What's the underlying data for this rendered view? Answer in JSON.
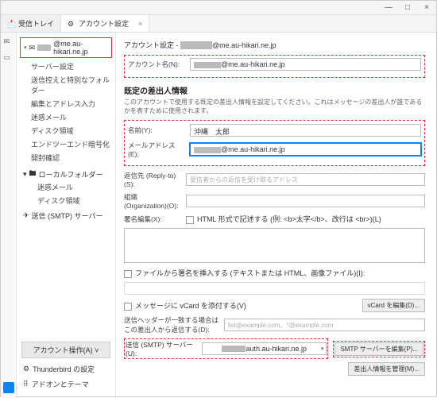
{
  "window": {
    "min": "—",
    "max": "□",
    "close": "×"
  },
  "tabs": {
    "inbox": "受信トレイ",
    "settings": "アカウント設定"
  },
  "account": {
    "domain": "@me.au-hikari.ne.jp"
  },
  "tree": {
    "server": "サーバー設定",
    "copies": "送信控えと特別なフォルダー",
    "compose": "編集とアドレス入力",
    "junk": "迷惑メール",
    "disk": "ディスク領域",
    "e2e": "エンドツーエンド暗号化",
    "receipt": "開封確認"
  },
  "local": {
    "hdr": "ローカルフォルダー",
    "junk": "迷惑メール",
    "disk": "ディスク領域"
  },
  "smtp": {
    "label": "送信 (SMTP) サーバー"
  },
  "sideops": {
    "acctops": "アカウント操作(A)",
    "tbset": "Thunderbird の設定",
    "addon": "アドオンとテーマ"
  },
  "h1": {
    "pre": "アカウント設定 - ",
    "dom": "@me.au-hikari.ne.jp"
  },
  "acctname": {
    "lbl": "アカウント名(N):",
    "val": "@me.au-hikari.ne.jp"
  },
  "sect": "既定の差出人情報",
  "hint": "このアカウントで使用する既定の差出人情報を設定してください。これはメッセージの差出人が誰であるかを表すために使用されます。",
  "name": {
    "lbl": "名前(Y):",
    "val": "沖縄　太郎"
  },
  "email": {
    "lbl": "メールアドレス(E):",
    "val": "@me.au-hikari.ne.jp"
  },
  "reply": {
    "lbl": "返信先 (Reply-to)(S):",
    "ph": "受信者からの返信を受け取るアドレス"
  },
  "org": {
    "lbl": "組織 (Organization)(O):"
  },
  "sig": {
    "lbl": "署名編集(X):",
    "cb": "HTML 形式で記述する (例: <b>太字</b>、改行は <br>)(L)"
  },
  "filesig": {
    "cb": "ファイルから署名を挿入する (テキストまたは HTML、画像ファイル)(I):"
  },
  "vcard": {
    "cb": "メッセージに vCard を添付する(V)",
    "btn": "vCard を編集(D)..."
  },
  "match": {
    "lbl": "送信ヘッダーが一致する場合はこの差出人から返信する(D):",
    "ph": "list@example.com、*@example.com"
  },
  "outsmtp": {
    "lbl": "送信 (SMTP) サーバー(U):",
    "val": "auth.au-hikari.ne.jp",
    "btn": "SMTP サーバーを編集(P)..."
  },
  "manage": {
    "btn": "差出人情報を管理(M)..."
  }
}
